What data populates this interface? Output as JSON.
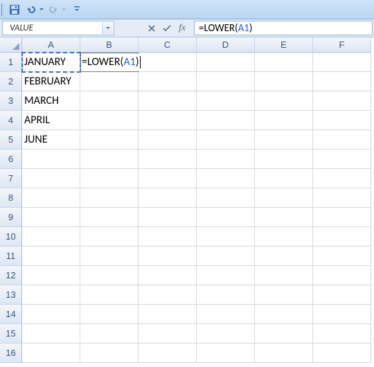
{
  "qat": {
    "save_icon": "save-icon",
    "undo_icon": "undo-icon",
    "redo_icon": "redo-icon"
  },
  "namebox": {
    "value": "VALUE"
  },
  "formula_bar": {
    "cancel_label": "✕",
    "enter_label": "✓",
    "fx_label": "fx",
    "formula_prefix": "=LOWER(",
    "formula_ref": "A1",
    "formula_suffix": ")"
  },
  "columns": [
    "A",
    "B",
    "C",
    "D",
    "E",
    "F"
  ],
  "row_numbers": [
    "1",
    "2",
    "3",
    "4",
    "5",
    "6",
    "7",
    "8",
    "9",
    "10",
    "11",
    "12",
    "13",
    "14",
    "15",
    "16"
  ],
  "cells": {
    "A1": "JANUARY",
    "A2": "FEBRUARY",
    "A3": "MARCH",
    "A4": "APRIL",
    "A5": "JUNE"
  },
  "editing_cell": {
    "address": "B1",
    "prefix": "=LOWER(",
    "ref": "A1",
    "suffix": ")"
  }
}
